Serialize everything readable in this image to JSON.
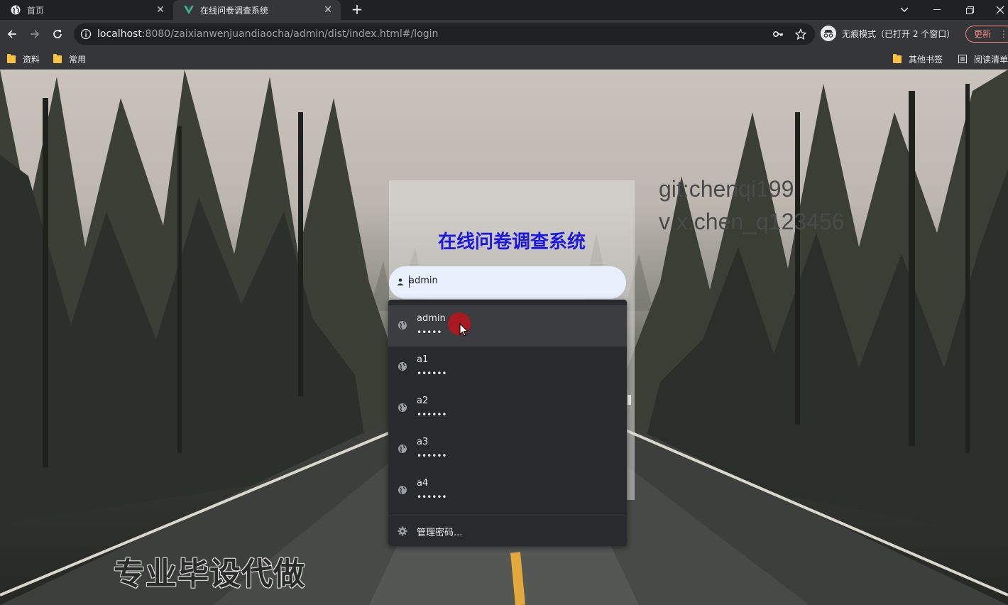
{
  "browser": {
    "tabs": [
      {
        "title": "首页",
        "icon": "globe-icon",
        "active": false
      },
      {
        "title": "在线问卷调查系统",
        "icon": "vue-logo-icon",
        "active": true
      }
    ],
    "new_tab_label": "+",
    "address": {
      "host": "localhost",
      "rest": ":8080/zaixianwenjuandiaocha/admin/dist/index.html#/login"
    },
    "incognito_label": "无痕模式（已打开 2 个窗口）",
    "update_label": "更新",
    "bookmarks": [
      {
        "label": "资料",
        "icon": "folder-icon"
      },
      {
        "label": "常用",
        "icon": "folder-icon"
      }
    ],
    "bookmarks_right": [
      {
        "label": "其他书签",
        "icon": "folder-icon"
      },
      {
        "label": "阅读清单",
        "icon": "reading-list-icon"
      }
    ]
  },
  "page": {
    "watermark_line1": "git:chenqi199",
    "watermark_line2": "v x:chen_q123456",
    "promo_text": "专业毕设代做",
    "login": {
      "title": "在线问卷调查系统",
      "username_value": "admin"
    }
  },
  "autofill": {
    "items": [
      {
        "username": "admin",
        "password_mask": "•••••",
        "highlighted": true
      },
      {
        "username": "a1",
        "password_mask": "••••••",
        "highlighted": false
      },
      {
        "username": "a2",
        "password_mask": "••••••",
        "highlighted": false
      },
      {
        "username": "a3",
        "password_mask": "••••••",
        "highlighted": false
      },
      {
        "username": "a4",
        "password_mask": "••••••",
        "highlighted": false
      }
    ],
    "manage_label": "管理密码..."
  },
  "colors": {
    "title_blue": "#1d18e0",
    "input_bg": "#e8f0fe",
    "dropdown_bg": "#292a2d",
    "click_indicator": "#b3161c",
    "update_red": "#f28b82"
  }
}
